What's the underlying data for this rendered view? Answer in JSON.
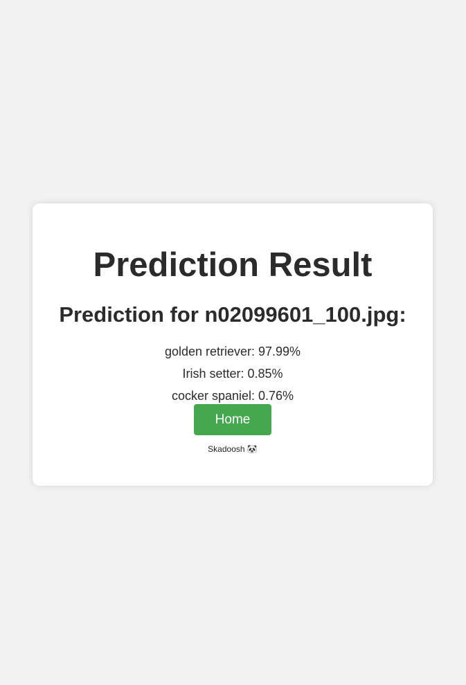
{
  "title": "Prediction Result",
  "subtitle": "Prediction for n02099601_100.jpg:",
  "predictions": [
    {
      "text": "golden retriever: 97.99%"
    },
    {
      "text": "Irish setter: 0.85%"
    },
    {
      "text": "cocker spaniel: 0.76%"
    }
  ],
  "home_label": "Home",
  "footer": "Skadoosh 🐼",
  "colors": {
    "button": "#45a84f",
    "background": "#f2f2f2"
  }
}
